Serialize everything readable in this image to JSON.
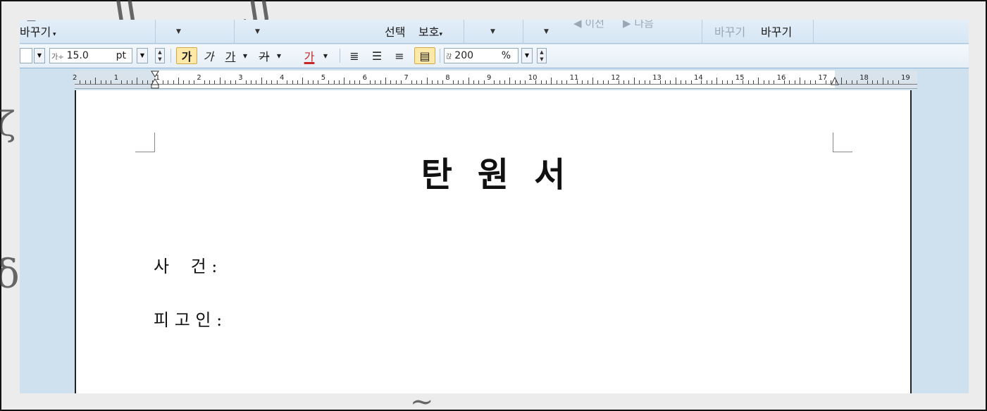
{
  "ribbon": {
    "change_label": "바꾸기",
    "select_label": "선택",
    "protect_label": "보호",
    "prev_label": "이전",
    "next_label": "다음",
    "change_dim_label": "바꾸기",
    "change_strong_label": "바꾸기"
  },
  "toolbar": {
    "font_size_value": "15.0",
    "font_size_unit": "pt",
    "bold_label": "가",
    "italic_label": "가",
    "underline_label": "가",
    "strike_label": "가",
    "color_label": "가",
    "line_spacing_value": "200",
    "line_spacing_unit": "%",
    "accent_color": "#c62828"
  },
  "ruler": {
    "labels": [
      "2",
      "1",
      "1",
      "2",
      "3",
      "4",
      "5",
      "6",
      "7",
      "8",
      "9",
      "10",
      "11",
      "12",
      "13",
      "14",
      "15",
      "16",
      "17",
      "18",
      "19"
    ]
  },
  "document": {
    "title": "탄원서",
    "case_label": "사    건 :",
    "defendant_label": "피 고 인 :"
  }
}
